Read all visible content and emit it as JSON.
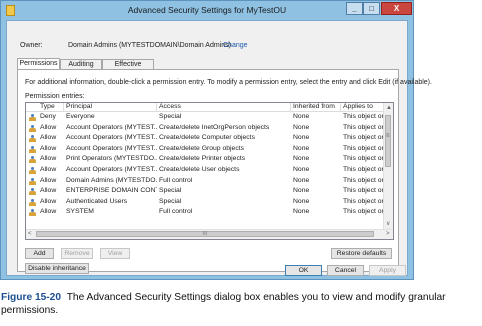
{
  "window": {
    "title": "Advanced Security Settings for MyTestOU",
    "minimize_glyph": "_",
    "maximize_glyph": "□",
    "close_glyph": "X"
  },
  "owner": {
    "label": "Owner:",
    "value": "Domain Admins (MYTESTDOMAIN\\Domain Admins)",
    "change_link": "Change"
  },
  "tabs": [
    "Permissions",
    "Auditing",
    "Effective Access"
  ],
  "permissions": {
    "description": "For additional information, double-click a permission entry. To modify a permission entry, select the entry and click Edit (if available).",
    "entries_label": "Permission entries:",
    "columns": [
      "Type",
      "Principal",
      "Access",
      "Inherited from",
      "Applies to"
    ],
    "rows": [
      {
        "type": "Deny",
        "principal": "Everyone",
        "access": "Special",
        "inherited": "None",
        "applies": "This object only"
      },
      {
        "type": "Allow",
        "principal": "Account Operators (MYTEST...",
        "access": "Create/delete InetOrgPerson objects",
        "inherited": "None",
        "applies": "This object only"
      },
      {
        "type": "Allow",
        "principal": "Account Operators (MYTEST...",
        "access": "Create/delete Computer objects",
        "inherited": "None",
        "applies": "This object only"
      },
      {
        "type": "Allow",
        "principal": "Account Operators (MYTEST...",
        "access": "Create/delete Group objects",
        "inherited": "None",
        "applies": "This object only"
      },
      {
        "type": "Allow",
        "principal": "Print Operators (MYTESTDO...",
        "access": "Create/delete Printer objects",
        "inherited": "None",
        "applies": "This object only"
      },
      {
        "type": "Allow",
        "principal": "Account Operators (MYTEST...",
        "access": "Create/delete User objects",
        "inherited": "None",
        "applies": "This object only"
      },
      {
        "type": "Allow",
        "principal": "Domain Admins (MYTESTDO...",
        "access": "Full control",
        "inherited": "None",
        "applies": "This object only"
      },
      {
        "type": "Allow",
        "principal": "ENTERPRISE DOMAIN CONT...",
        "access": "Special",
        "inherited": "None",
        "applies": "This object only"
      },
      {
        "type": "Allow",
        "principal": "Authenticated Users",
        "access": "Special",
        "inherited": "None",
        "applies": "This object only"
      },
      {
        "type": "Allow",
        "principal": "SYSTEM",
        "access": "Full control",
        "inherited": "None",
        "applies": "This object only"
      }
    ]
  },
  "buttons": {
    "add": "Add",
    "remove": "Remove",
    "view": "View",
    "restore_defaults": "Restore defaults",
    "disable_inheritance": "Disable inheritance",
    "ok": "OK",
    "cancel": "Cancel",
    "apply": "Apply"
  },
  "scrollbar": {
    "up": "▲",
    "down": "∨",
    "left": "<",
    "right": ">",
    "grip": "III",
    "vgrip": "≡"
  },
  "figure_caption": {
    "number": "Figure 15-20",
    "text": "The Advanced Security Settings dialog box enables you to view and modify granular permissions."
  },
  "colors": {
    "title_bar": "#8fc1e2",
    "close_button": "#c9473f",
    "link": "#1e57a8",
    "caption_number": "#1d4f91"
  }
}
